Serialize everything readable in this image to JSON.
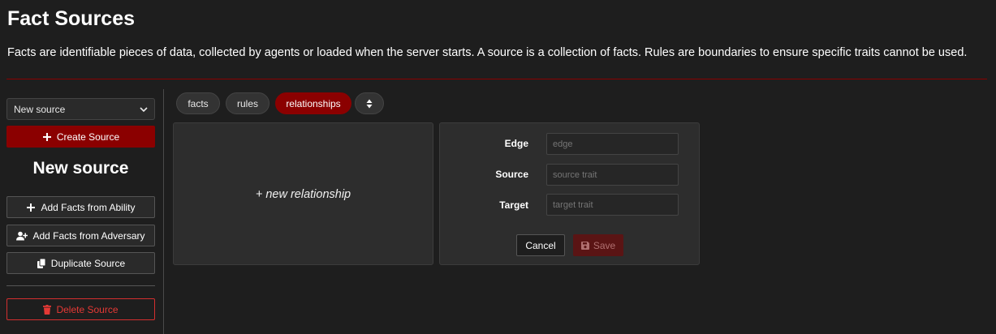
{
  "header": {
    "title": "Fact Sources",
    "description": "Facts are identifiable pieces of data, collected by agents or loaded when the server starts. A source is a collection of facts. Rules are boundaries to ensure specific traits cannot be used."
  },
  "sidebar": {
    "selected_source": "New source",
    "create_label": "Create Source",
    "source_name": "New source",
    "add_facts_ability_label": "Add Facts from Ability",
    "add_facts_adversary_label": "Add Facts from Adversary",
    "duplicate_label": "Duplicate Source",
    "delete_label": "Delete Source"
  },
  "tabs": [
    {
      "label": "facts"
    },
    {
      "label": "rules"
    },
    {
      "label": "relationships",
      "active": true
    }
  ],
  "relationships": {
    "new_label": "+ new relationship"
  },
  "form": {
    "edge_label": "Edge",
    "edge_placeholder": "edge",
    "source_label": "Source",
    "source_placeholder": "source trait",
    "target_label": "Target",
    "target_placeholder": "target trait",
    "cancel_label": "Cancel",
    "save_label": "Save"
  },
  "colors": {
    "accent": "#8b0000",
    "danger": "#e53935",
    "background": "#1e1e1e"
  }
}
